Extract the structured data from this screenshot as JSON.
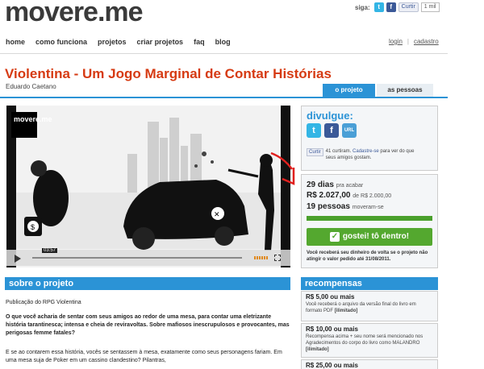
{
  "header": {
    "logo": "movere.me",
    "siga_label": "siga:",
    "curtir_label": "Curtir",
    "curtir_count": "1 mil"
  },
  "nav": {
    "items": [
      "home",
      "como funciona",
      "projetos",
      "criar projetos",
      "faq",
      "blog"
    ],
    "login": "login",
    "separator": "|",
    "cadastro": "cadastro"
  },
  "project": {
    "title": "Violentina - Um Jogo Marginal de Contar Histórias",
    "author": "Eduardo Caetano",
    "tabs": {
      "active": "o projeto",
      "inactive": "as pessoas"
    }
  },
  "video": {
    "overlay_logo": "movere.me",
    "time": "03:57"
  },
  "divulgue": {
    "heading": "divulgue:",
    "icons": [
      "twitter-icon",
      "facebook-icon",
      "url-icon"
    ],
    "url_label": "URL",
    "fb_button": "Curtir",
    "fb_count_text": "41 curtiram.",
    "fb_cta": "Cadastre-se",
    "fb_rest": "para ver do que seus amigos gostam."
  },
  "stats": {
    "days_value": "29 dias",
    "days_label": "pra acabar",
    "raised_value": "R$ 2.027,00",
    "raised_label": "de R$ 2.000,00",
    "people_value": "19 pessoas",
    "people_label": "moveram-se",
    "progress_fraction": 1.0,
    "button_label": "gostei! tô dentro!",
    "refund_note": "Você receberá seu dinheiro de volta se o projeto não atingir o valor pedido até 31/08/2011."
  },
  "sobre": {
    "heading": "sobre o projeto",
    "p1": "Publicação do RPG Violentina",
    "p2": "O que você acharia de sentar com seus amigos ao redor de uma mesa, para contar uma eletrizante história tarantinesca; intensa e cheia de reviravoltas. Sobre mafiosos inescrupulosos e provocantes, mas perigosas femme fatales?",
    "p3": "E se ao contarem essa história, vocês se sentassem à mesa, exatamente como seus personagens fariam. Em uma mesa suja de Poker em um cassino clandestino? Pilantras,"
  },
  "recompensas": {
    "heading": "recompensas",
    "items": [
      {
        "price": "R$ 5,00 ou mais",
        "desc": "Você receberá o arquivo da versão final do livro em formato PDF",
        "tag": "[ilimitado]"
      },
      {
        "price": "R$ 10,00 ou mais",
        "desc": "Recompensa acima + seu nome será mencionado nos Agradecimentos do corpo do livro como MALANDRO",
        "tag": "[ilimitado]"
      },
      {
        "price": "R$ 25,00 ou mais",
        "desc": "",
        "tag": ""
      }
    ]
  },
  "colors": {
    "accent": "#2b93d6",
    "title": "#d63a12",
    "success": "#54a82f",
    "annotation": "#e0201e"
  }
}
